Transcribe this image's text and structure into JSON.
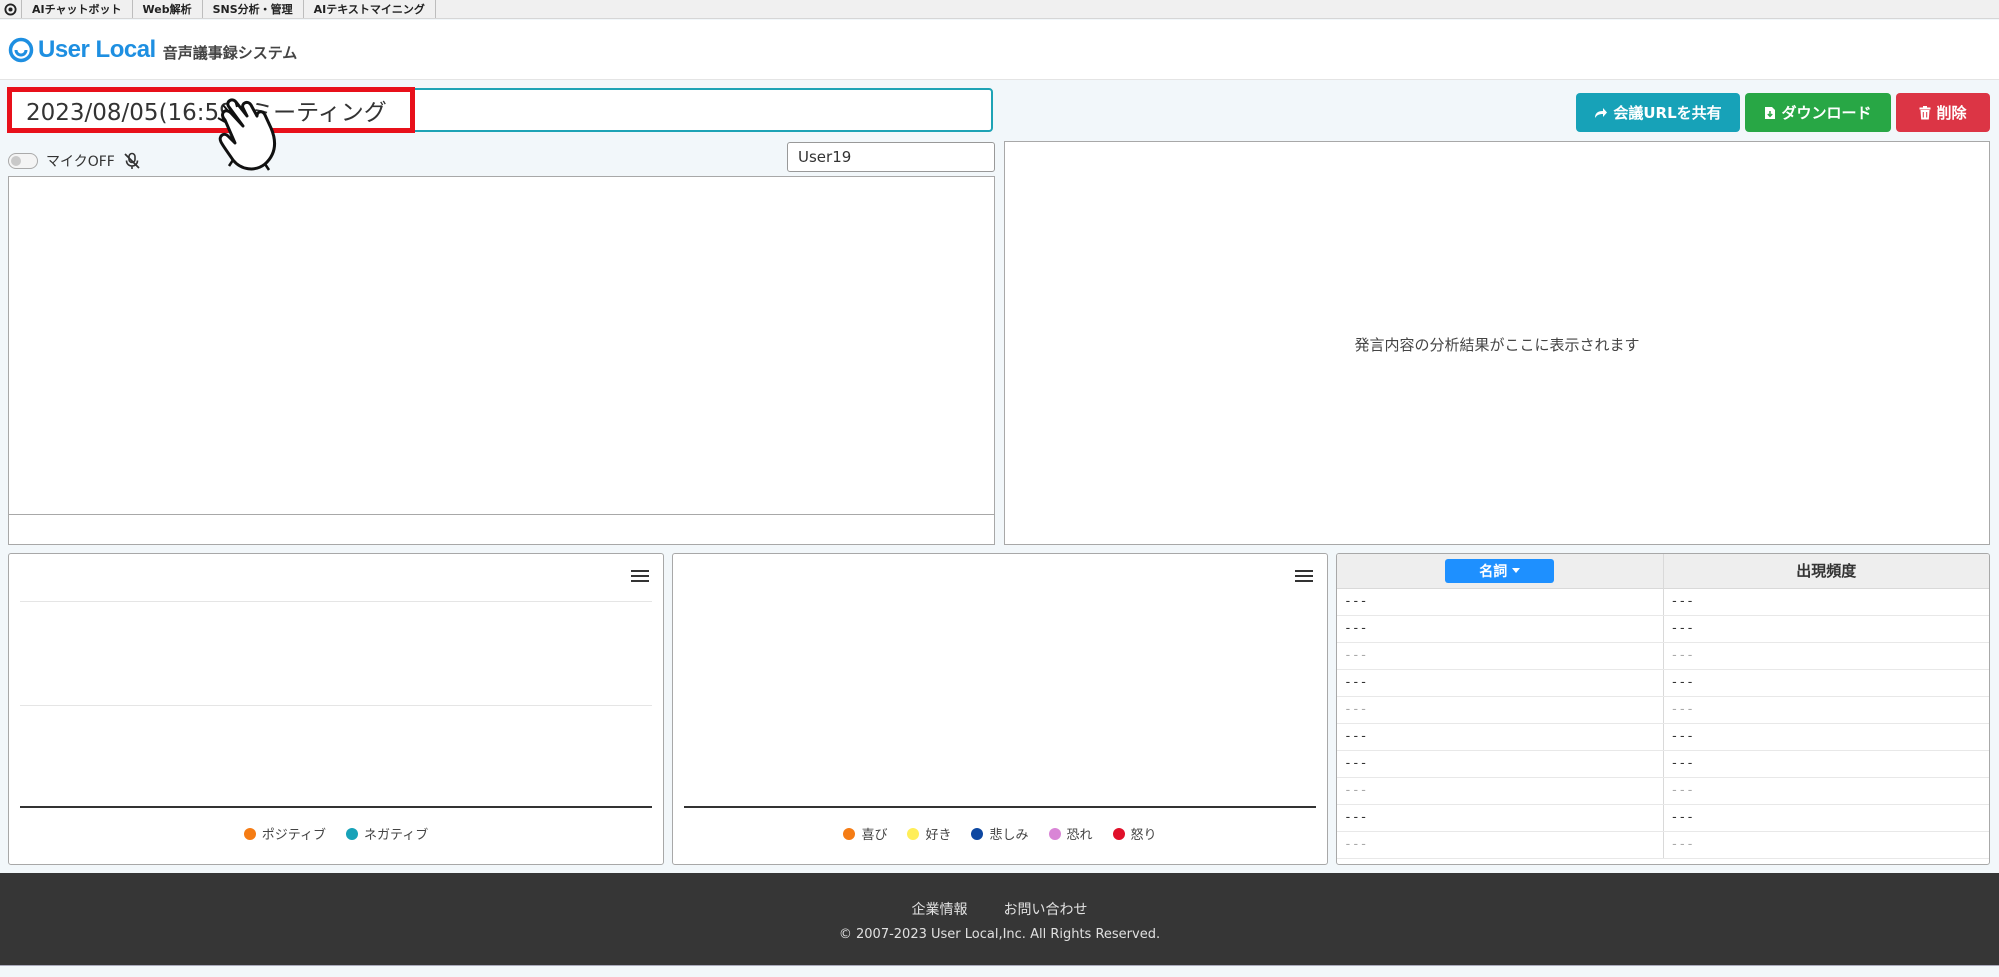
{
  "topbar": {
    "services": [
      "AIチャットボット",
      "Web解析",
      "SNS分析・管理",
      "AIテキストマイニング"
    ]
  },
  "header": {
    "brand": "User Local",
    "app_name": "音声議事録システム"
  },
  "meeting": {
    "title": "2023/08/05(16:59) ミーティング",
    "user_name": "User19"
  },
  "actions": {
    "share": "会議URLを共有",
    "download": "ダウンロード",
    "delete": "削除"
  },
  "mic": {
    "label": "マイクOFF"
  },
  "analysis": {
    "placeholder": "発言内容の分析結果がここに表示されます"
  },
  "sentiment_chart": {
    "legend": [
      "ポジティブ",
      "ネガティブ"
    ]
  },
  "emotion_chart": {
    "legend": [
      "喜び",
      "好き",
      "悲しみ",
      "恐れ",
      "怒り"
    ]
  },
  "frequency_table": {
    "pos_label": "名詞",
    "count_header": "出現頻度",
    "rows": [
      [
        "---",
        "---"
      ],
      [
        "---",
        "---"
      ],
      [
        "---",
        "---"
      ],
      [
        "---",
        "---"
      ],
      [
        "---",
        "---"
      ],
      [
        "---",
        "---"
      ],
      [
        "---",
        "---"
      ],
      [
        "---",
        "---"
      ],
      [
        "---",
        "---"
      ],
      [
        "---",
        "---"
      ]
    ]
  },
  "footer": {
    "company": "企業情報",
    "contact": "お問い合わせ",
    "copyright": "© 2007-2023 User Local,Inc. All Rights Reserved."
  },
  "colors": {
    "brand_blue": "#1e8fe1",
    "share_teal": "#17a2b8",
    "download_green": "#28a745",
    "delete_red": "#dc3545",
    "highlight_red": "#e8101a",
    "positive": "#f57c14",
    "negative": "#17a2b8",
    "joy": "#f57c14",
    "like": "#ffee58",
    "sadness": "#0d47a1",
    "fear": "#d985d6",
    "anger": "#e0102a"
  }
}
